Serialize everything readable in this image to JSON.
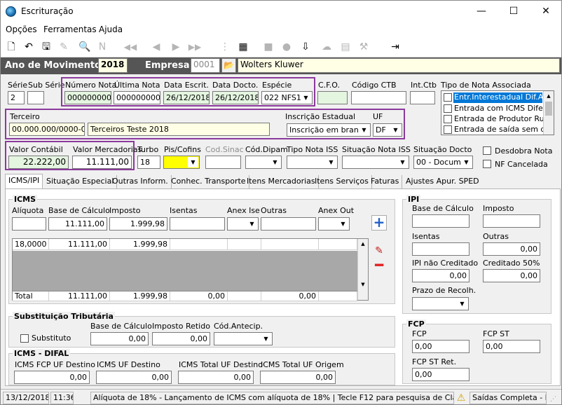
{
  "window": {
    "title": "Escrituração",
    "min": "—",
    "max": "☐",
    "close": "✕"
  },
  "menu": [
    "Opções",
    "Ferramentas",
    "Ajuda"
  ],
  "header": {
    "ano_label": "Ano de Movimento",
    "ano_value": "2018",
    "empresa_label": "Empresa",
    "empresa_code": "0001",
    "empresa_name": "Wolters Kluwer"
  },
  "nota": {
    "serie_label": "Série",
    "subserie_label": "Sub Série",
    "serie_value": "2",
    "subserie_value": "",
    "numero_label": "Número Nota",
    "numero_value": "0000000002",
    "ultima_label": "Última Nota",
    "ultima_value": "0000000002",
    "escrit_label": "Data Escrit.",
    "escrit_value": "26/12/2018",
    "docto_label": "Data Docto.",
    "docto_value": "26/12/2018",
    "especie_label": "Espécie",
    "especie_value": "022  NFS1",
    "cfo_label": "C.F.O.",
    "cfo_value": "",
    "ctb_label": "Código CTB",
    "ctb_value": "",
    "intctb_label": "Int.Ctb",
    "intctb_value": ""
  },
  "tipo_nota": {
    "label": "Tipo de Nota Associada",
    "items": [
      "Entr.Interestadual Dif.Alíq",
      "Entrada com ICMS Diferido",
      "Entrada de Produtor Rural",
      "Entrada de saída sem débi"
    ]
  },
  "terceiro": {
    "label": "Terceiro",
    "cnpj": "00.000.000/0000-00",
    "nome": "Terceiros Teste 2018",
    "ie_label": "Inscrição Estadual",
    "ie_value": "Inscrição em branco",
    "uf_label": "UF",
    "uf_value": "DF"
  },
  "valores": {
    "contabil_label": "Valor Contábil",
    "contabil_value": "22.222,00",
    "merc_label": "Valor Mercadorias",
    "merc_value": "11.111,00",
    "turbo_label": "Turbo",
    "turbo_value": "18",
    "piscofins_label": "Pis/Cofins",
    "codsinac_label": "Cod.Sinac",
    "coddipam_label": "Cód.Dipam",
    "tiponotaiss_label": "Tipo Nota ISS",
    "situacaoiss_label": "Situação Nota ISS",
    "situacaodocto_label": "Situação Docto",
    "situacaodocto_value": "00 - Documer",
    "desdobra_label": "Desdobra Nota",
    "nfcancelada_label": "NF Cancelada"
  },
  "tabs": [
    "ICMS/IPI",
    "Situação Especial",
    "Outras Inform.",
    "Conhec. Transporte",
    "Itens Mercadorias",
    "Itens Serviços",
    "Faturas",
    "Ajustes Apur. SPED"
  ],
  "icms": {
    "title": "ICMS",
    "aliquota_label": "Alíquota",
    "base_label": "Base de Cálculo",
    "imposto_label": "Imposto",
    "isentas_label": "Isentas",
    "anexise_label": "Anex Ise",
    "outras_label": "Outras",
    "anexout_label": "Anex Out",
    "aliquota_value": "",
    "base_value": "11.111,00",
    "imposto_value": "1.999,98",
    "row": [
      "18,0000",
      "11.111,00",
      "1.999,98",
      "",
      "",
      "",
      ""
    ],
    "total": [
      "Total",
      "11.111,00",
      "1.999,98",
      "0,00",
      "",
      "0,00",
      ""
    ]
  },
  "st": {
    "title": "Substituição Tributária",
    "substituto_label": "Substituto",
    "base_label": "Base de Cálculo",
    "base_value": "0,00",
    "retido_label": "Imposto Retido",
    "retido_value": "0,00",
    "codantecip_label": "Cód.Antecip."
  },
  "difal": {
    "title": "ICMS - DIFAL",
    "fcp_label": "ICMS FCP UF Destino",
    "fcp_value": "0,00",
    "ufdest_label": "ICMS UF Destino",
    "ufdest_value": "0,00",
    "total_label": "ICMS Total UF Destino",
    "total_value": "0,00",
    "origem_label": "ICMS Total UF Origem",
    "origem_value": "0,00"
  },
  "ipi": {
    "title": "IPI",
    "base_label": "Base de Cálculo",
    "base_value": "",
    "imposto_label": "Imposto",
    "imposto_value": "",
    "isentas_label": "Isentas",
    "isentas_value": "",
    "outras_label": "Outras",
    "outras_value": "0,00",
    "naocred_label": "IPI não Creditado",
    "naocred_value": "0,00",
    "cred50_label": "Creditado 50%",
    "cred50_value": "0,00",
    "prazo_label": "Prazo de Recolh."
  },
  "fcp": {
    "title": "FCP",
    "fcp_label": "FCP",
    "fcp_value": "0,00",
    "fcpst_label": "FCP ST",
    "fcpst_value": "0,00",
    "fcpstret_label": "FCP ST Ret.",
    "fcpstret_value": "0,00"
  },
  "status": {
    "date": "13/12/2018",
    "time": "11:36",
    "message": "Alíquota de 18% - Lançamento de ICMS com alíquota de 18% | Tecle F12 para pesquisa de Classe de Recoll",
    "mode": "Saídas Completa - Pros"
  }
}
